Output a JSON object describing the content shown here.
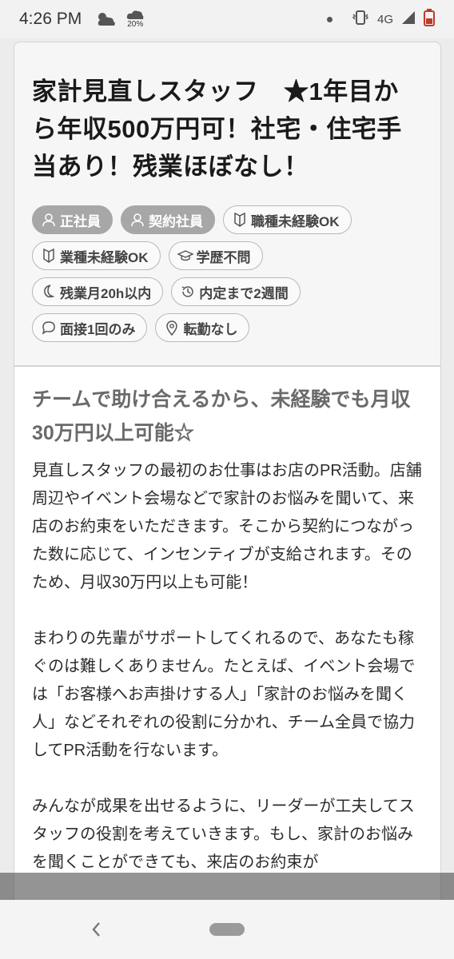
{
  "status_bar": {
    "time": "4:26 PM",
    "weather_percent": "20%",
    "network": "4G",
    "icons": [
      "cloudy-icon",
      "rain-icon",
      "notification-dot-icon",
      "vibrate-icon",
      "signal-icon",
      "battery-icon"
    ]
  },
  "job": {
    "title": "家計見直しスタッフ　★1年目から年収500万円可！社宅・住宅手当あり！残業ほぼなし！",
    "tags": [
      {
        "label": "正社員",
        "icon": "person-icon",
        "filled": true
      },
      {
        "label": "契約社員",
        "icon": "person-icon",
        "filled": true
      },
      {
        "label": "職種未経験OK",
        "icon": "beginner-icon",
        "filled": false
      },
      {
        "label": "業種未経験OK",
        "icon": "beginner-icon",
        "filled": false
      },
      {
        "label": "学歴不問",
        "icon": "graduation-cap-icon",
        "filled": false
      },
      {
        "label": "残業月20h以内",
        "icon": "moon-icon",
        "filled": false
      },
      {
        "label": "内定まで2週間",
        "icon": "history-clock-icon",
        "filled": false
      },
      {
        "label": "面接1回のみ",
        "icon": "chat-bubble-icon",
        "filled": false
      },
      {
        "label": "転勤なし",
        "icon": "location-pin-icon",
        "filled": false
      }
    ],
    "subtitle": "チームで助け合えるから、未経験でも月収30万円以上可能☆",
    "paragraphs": [
      "見直しスタッフの最初のお仕事はお店のPR活動。店舗周辺やイベント会場などで家計のお悩みを聞いて、来店のお約束をいただきます。そこから契約につながった数に応じて、インセンティブが支給されます。そのため、月収30万円以上も可能！",
      "まわりの先輩がサポートしてくれるので、あなたも稼ぐのは難しくありません。たとえば、イベント会場では「お客様へお声掛けする人」「家計のお悩みを聞く人」などそれぞれの役割に分かれ、チーム全員で協力してPR活動を行ないます。",
      "みんなが成果を出せるように、リーダーが工夫してスタッフの役割を考えていきます。もし、家計のお悩みを聞くことができても、来店のお約束が"
    ]
  },
  "colors": {
    "accent_tag_fill": "#a7a7a7",
    "subtitle": "#6a6a6a"
  }
}
